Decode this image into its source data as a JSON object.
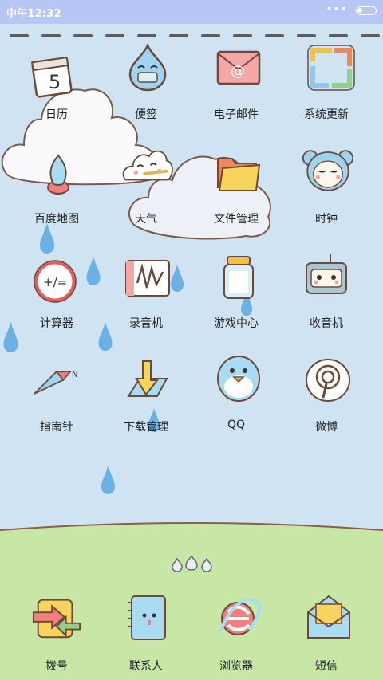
{
  "status_bar": {
    "time": "中午12:32",
    "menu_dots": "•••"
  },
  "apps": [
    {
      "label": "日历",
      "icon": "calendar-icon"
    },
    {
      "label": "便签",
      "icon": "notes-icon"
    },
    {
      "label": "电子邮件",
      "icon": "email-icon"
    },
    {
      "label": "系统更新",
      "icon": "system-update-icon"
    },
    {
      "label": "百度地图",
      "icon": "map-pin-icon"
    },
    {
      "label": "天气",
      "icon": "weather-icon"
    },
    {
      "label": "文件管理",
      "icon": "folder-icon"
    },
    {
      "label": "时钟",
      "icon": "clock-bear-icon"
    },
    {
      "label": "计算器",
      "icon": "calculator-icon"
    },
    {
      "label": "录音机",
      "icon": "recorder-icon"
    },
    {
      "label": "游戏中心",
      "icon": "game-jar-icon"
    },
    {
      "label": "收音机",
      "icon": "radio-icon"
    },
    {
      "label": "指南针",
      "icon": "compass-icon"
    },
    {
      "label": "下载管理",
      "icon": "download-icon"
    },
    {
      "label": "QQ",
      "icon": "qq-penguin-icon"
    },
    {
      "label": "微博",
      "icon": "weibo-icon"
    }
  ],
  "dock": [
    {
      "label": "拨号",
      "icon": "phone-dial-icon"
    },
    {
      "label": "联系人",
      "icon": "contacts-icon"
    },
    {
      "label": "浏览器",
      "icon": "browser-icon"
    },
    {
      "label": "短信",
      "icon": "sms-icon"
    }
  ],
  "calendar_day": "5",
  "calc_text": "+/=",
  "colors": {
    "sky": "#cfe3f2",
    "status_bar": "#b8c6f5",
    "grass": "#c8e6a6",
    "drop": "#6bb1e4"
  }
}
